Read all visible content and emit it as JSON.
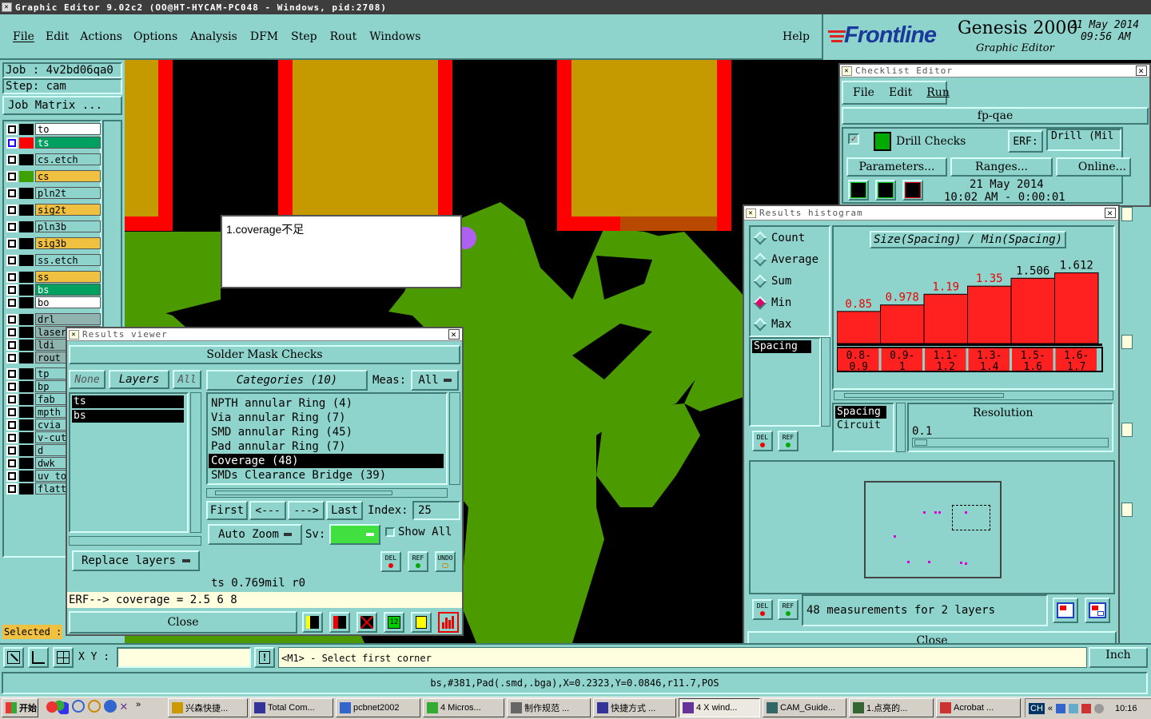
{
  "window": {
    "title": "Graphic Editor 9.02c2 (OO@HT-HYCAM-PC048 - Windows, pid:2708)"
  },
  "menu": {
    "items": [
      "File",
      "Edit",
      "Actions",
      "Options",
      "Analysis",
      "DFM",
      "Step",
      "Rout",
      "Windows"
    ],
    "help": "Help"
  },
  "brand": {
    "logo": "Frontline",
    "product": "Genesis 2000",
    "subtitle": "Graphic Editor",
    "date": "21 May 2014",
    "time": "09:56 AM"
  },
  "job": {
    "job": "Job : 4v2bd06qa0",
    "step": "Step: cam",
    "matrix": "Job Matrix ..."
  },
  "layers": [
    {
      "name": "to",
      "color": "#ffffff",
      "chip": "#000000"
    },
    {
      "name": "ts",
      "color": "#00a060",
      "chip": "#ff0000",
      "active": true
    },
    {
      "name": "cs.etch",
      "color": "#8fd4cc",
      "chip": "#000000"
    },
    {
      "name": "cs",
      "color": "#f0c040",
      "chip": "#40a000"
    },
    {
      "name": "pln2t",
      "color": "#8fd4cc",
      "chip": "#000000"
    },
    {
      "name": "sig2t",
      "color": "#f0c040",
      "chip": "#000000"
    },
    {
      "name": "pln3b",
      "color": "#8fd4cc",
      "chip": "#000000"
    },
    {
      "name": "sig3b",
      "color": "#f0c040",
      "chip": "#000000"
    },
    {
      "name": "ss.etch",
      "color": "#8fd4cc",
      "chip": "#000000"
    },
    {
      "name": "ss",
      "color": "#f0c040",
      "chip": "#000000"
    },
    {
      "name": "bs",
      "color": "#00a060",
      "chip": "#000000"
    },
    {
      "name": "bo",
      "color": "#ffffff",
      "chip": "#000000"
    },
    {
      "name": "drl",
      "color": "#8fb4b0",
      "chip": "#000000"
    },
    {
      "name": "laser",
      "color": "#8fb4b0",
      "chip": "#000000"
    },
    {
      "name": "ldi",
      "color": "#8fb4b0",
      "chip": "#000000"
    },
    {
      "name": "rout",
      "color": "#8fb4b0",
      "chip": "#000000"
    },
    {
      "name": "tp",
      "color": "#8fd4cc",
      "chip": "#000000"
    },
    {
      "name": "bp",
      "color": "#8fd4cc",
      "chip": "#000000"
    },
    {
      "name": "fab",
      "color": "#8fd4cc",
      "chip": "#000000"
    },
    {
      "name": "mpth",
      "color": "#8fd4cc",
      "chip": "#000000"
    },
    {
      "name": "cvia",
      "color": "#8fd4cc",
      "chip": "#000000"
    },
    {
      "name": "v-cut",
      "color": "#8fd4cc",
      "chip": "#000000"
    },
    {
      "name": "d",
      "color": "#8fd4cc",
      "chip": "#000000"
    },
    {
      "name": "dwk",
      "color": "#8fd4cc",
      "chip": "#000000"
    },
    {
      "name": "uv_to",
      "color": "#8fd4cc",
      "chip": "#000000"
    },
    {
      "name": "flatt",
      "color": "#8fd4cc",
      "chip": "#000000"
    }
  ],
  "selected_label": "Selected :",
  "note": {
    "text": "1.coverage不足"
  },
  "results_viewer": {
    "title": "Results viewer",
    "heading": "Solder Mask Checks",
    "none": "None",
    "layers": "Layers",
    "all": "All",
    "categories": "Categories (10)",
    "meas_label": "Meas:",
    "meas_value": "All",
    "layer_list": [
      "ts",
      "bs"
    ],
    "category_list": [
      "NPTH annular Ring (4)",
      "Via annular Ring (7)",
      "SMD annular Ring (45)",
      "Pad annular Ring (7)",
      "Coverage (48)",
      "SMDs Clearance Bridge (39)"
    ],
    "selected_category": 4,
    "first": "First",
    "prev": "<---",
    "next": "--->",
    "last": "Last",
    "index_label": "Index:",
    "index_value": "25",
    "auto_zoom": "Auto Zoom",
    "sv": "Sv:",
    "show_all": "Show All",
    "replace_layers": "Replace layers",
    "del": "DEL",
    "ref": "REF",
    "undo": "UNDO",
    "status1": "ts 0.769mil  r0",
    "status2": "ERF--> coverage = 2.5 6 8",
    "close": "Close"
  },
  "checklist": {
    "title": "Checklist Editor",
    "menu": [
      "File",
      "Edit",
      "Run"
    ],
    "name": "fp-qae",
    "drill_checks": "Drill Checks",
    "erf": "ERF:",
    "erf_value": "Drill (Mil",
    "parameters": "Parameters...",
    "ranges": "Ranges...",
    "online": "Online...",
    "date": "21 May 2014",
    "time": "10:02 AM - 0:00:01"
  },
  "histogram": {
    "title": "Results histogram",
    "options": [
      "Count",
      "Average",
      "Sum",
      "Min",
      "Max"
    ],
    "selected_option": 3,
    "graph_title": "Size(Spacing) / Min(Spacing)",
    "list": [
      "Spacing"
    ],
    "types": [
      "Spacing",
      "Circuit"
    ],
    "resolution_label": "Resolution",
    "resolution_value": "0.1",
    "summary": "48 measurements for 2 layers",
    "close": "Close",
    "del": "DEL",
    "ref": "REF"
  },
  "chart_data": {
    "type": "bar",
    "title": "Size(Spacing) / Min(Spacing)",
    "categories": [
      "0.8-0.9",
      "0.9-1",
      "1.1-1.2",
      "1.3-1.4",
      "1.5-1.6",
      "1.6-1.7"
    ],
    "category_lines": [
      [
        "0.8-",
        "0.9"
      ],
      [
        "0.9-",
        "1"
      ],
      [
        "1.1-",
        "1.2"
      ],
      [
        "1.3-",
        "1.4"
      ],
      [
        "1.5-",
        "1.6"
      ],
      [
        "1.6-",
        "1.7"
      ]
    ],
    "values": [
      0.85,
      0.978,
      1.19,
      1.35,
      1.506,
      1.612
    ],
    "labels": [
      "0.85",
      "0.978",
      "1.19",
      "1.35",
      "1.506",
      "1.612"
    ],
    "ylim": [
      0.5,
      1.7
    ],
    "color": "#ff2020"
  },
  "bottom": {
    "xy_label": "X Y :",
    "prompt": "<M1> - Select first corner",
    "units": "Inch",
    "status": "bs,#381,Pad(.smd,.bga),X=0.2323,Y=0.0846,r11.7,POS"
  },
  "taskbar": {
    "start": "开始",
    "items": [
      "兴森快捷...",
      "Total Com...",
      "pcbnet2002",
      "4 Micros...",
      "制作规范 ...",
      "快捷方式 ...",
      "4 X wind...",
      "CAM_Guide...",
      "1.点亮的...",
      "Acrobat ..."
    ],
    "lang": "CH",
    "clock": "10:16"
  }
}
